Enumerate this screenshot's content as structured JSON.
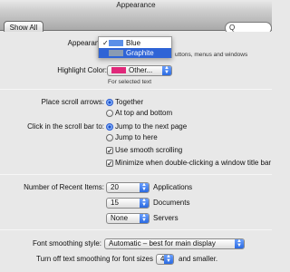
{
  "window": {
    "title": "Appearance"
  },
  "toolbar": {
    "show_all_label": "Show All",
    "search_placeholder": "Q"
  },
  "appearance": {
    "label": "Appearance:",
    "menu": {
      "items": [
        {
          "label": "Blue",
          "checked": true,
          "selected": false
        },
        {
          "label": "Graphite",
          "checked": false,
          "selected": true
        }
      ]
    },
    "help_text": "uttons, menus and windows",
    "swatch_colors": {
      "blue": "#5b8fe8",
      "graphite": "#8a9bb2"
    }
  },
  "highlight": {
    "label": "Highlight Color:",
    "value": "Other...",
    "swatch_color": "#e0287a",
    "help_text": "For selected text"
  },
  "scroll_arrows": {
    "label": "Place scroll arrows:",
    "options": [
      {
        "label": "Together",
        "selected": true
      },
      {
        "label": "At top and bottom",
        "selected": false
      }
    ]
  },
  "scroll_bar": {
    "label": "Click in the scroll bar to:",
    "options": [
      {
        "label": "Jump to the next page",
        "selected": true
      },
      {
        "label": "Jump to here",
        "selected": false
      }
    ],
    "checkboxes": [
      {
        "label": "Use smooth scrolling",
        "checked": true
      },
      {
        "label": "Minimize when double-clicking a window title bar",
        "checked": true
      }
    ]
  },
  "recent_items": {
    "label": "Number of Recent Items:",
    "rows": [
      {
        "value": "20",
        "label": "Applications"
      },
      {
        "value": "15",
        "label": "Documents"
      },
      {
        "value": "None",
        "label": "Servers"
      }
    ]
  },
  "font_smoothing": {
    "label": "Font smoothing style:",
    "value": "Automatic – best for main display",
    "turn_off_label": "Turn off text smoothing for font sizes",
    "size_value": "4",
    "suffix": "and smaller."
  }
}
